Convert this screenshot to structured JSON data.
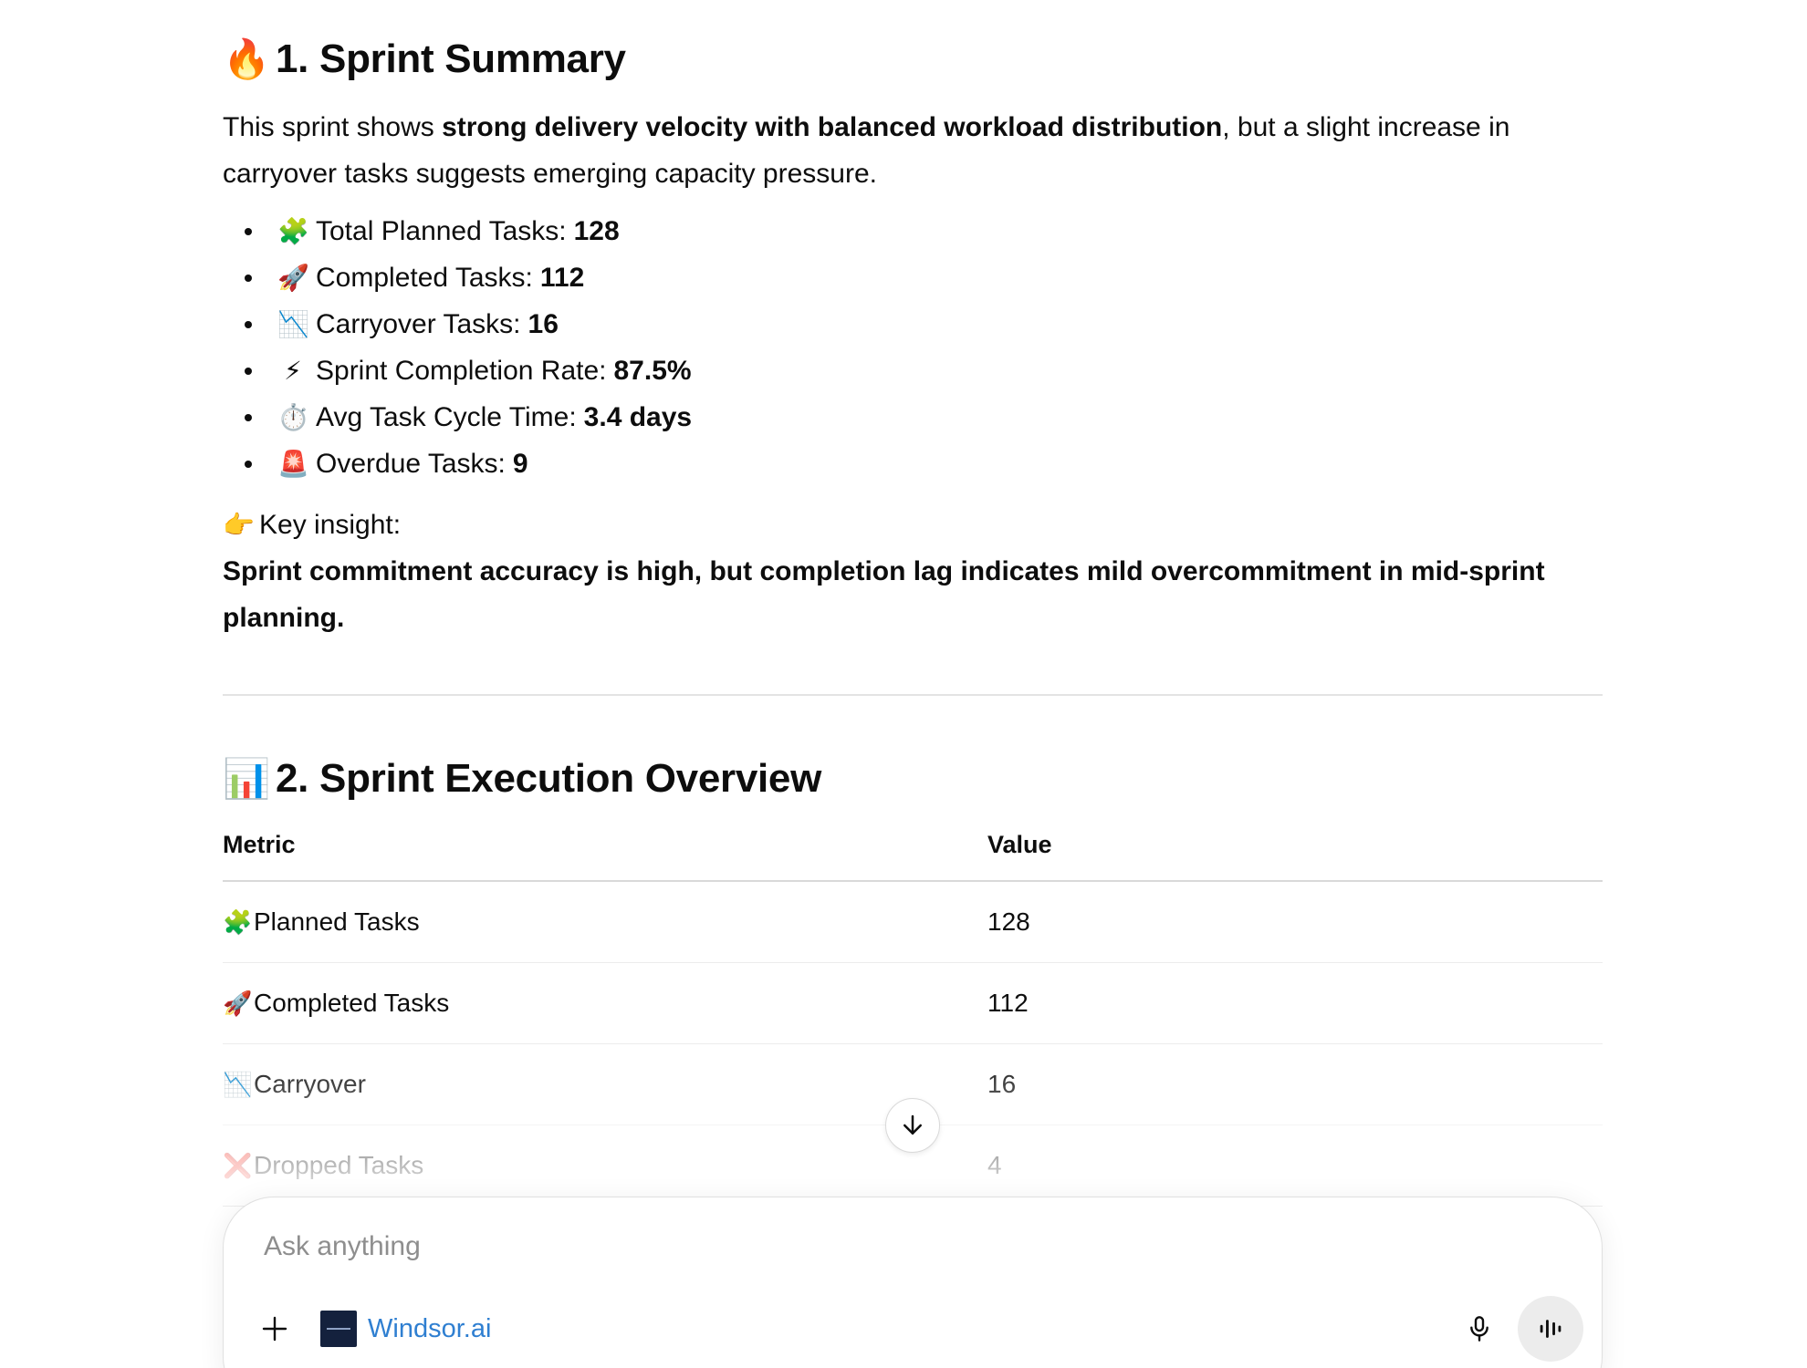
{
  "section1": {
    "icon": "fire-icon",
    "emoji": "🔥",
    "title": "1. Sprint Summary",
    "summary_pre": "This sprint shows ",
    "summary_bold": "strong delivery velocity with balanced workload distribution",
    "summary_post": ", but a slight increase in carryover tasks suggests emerging capacity pressure.",
    "stats": [
      {
        "icon": "puzzle-icon",
        "emoji": "🧩",
        "label": "Total Planned Tasks:",
        "value": "128"
      },
      {
        "icon": "rocket-icon",
        "emoji": "🚀",
        "label": "Completed Tasks:",
        "value": "112"
      },
      {
        "icon": "chart-decreasing-icon",
        "emoji": "📉",
        "label": "Carryover Tasks:",
        "value": "16"
      },
      {
        "icon": "lightning-icon",
        "emoji": "⚡",
        "label": "Sprint Completion Rate:",
        "value": "87.5%"
      },
      {
        "icon": "stopwatch-icon",
        "emoji": "⏱️",
        "label": "Avg Task Cycle Time:",
        "value": "3.4 days"
      },
      {
        "icon": "siren-icon",
        "emoji": "🚨",
        "label": "Overdue Tasks:",
        "value": "9"
      }
    ],
    "insight_emoji": "👉",
    "insight_label": "Key insight:",
    "insight_text": "Sprint commitment accuracy is high, but completion lag indicates mild overcommitment in mid-sprint planning."
  },
  "section2": {
    "icon": "bar-chart-icon",
    "emoji": "📊",
    "title": "2. Sprint Execution Overview",
    "headers": {
      "metric": "Metric",
      "value": "Value"
    },
    "rows": [
      {
        "icon": "puzzle-icon",
        "emoji": "🧩",
        "metric": "Planned Tasks",
        "value": "128"
      },
      {
        "icon": "rocket-icon",
        "emoji": "🚀",
        "metric": "Completed Tasks",
        "value": "112"
      },
      {
        "icon": "chart-decreasing-icon",
        "emoji": "📉",
        "metric": "Carryover",
        "value": "16"
      },
      {
        "icon": "cross-mark-icon",
        "emoji": "❌",
        "metric": "Dropped Tasks",
        "value": "4"
      }
    ]
  },
  "composer": {
    "placeholder": "Ask anything",
    "value": "",
    "connector_label": "Windsor.ai",
    "icons": {
      "add": "plus-icon",
      "connector": "windsor-logo-icon",
      "mic": "microphone-icon",
      "voice": "voice-waveform-icon",
      "scroll": "arrow-down-icon"
    }
  },
  "colors": {
    "text": "#0d0d0d",
    "link": "#2f7fd1",
    "placeholder": "#8e8e8e",
    "divider": "#e3e3e3",
    "voice_button_bg": "#ececec",
    "connector_logo_bg": "#14213d"
  }
}
